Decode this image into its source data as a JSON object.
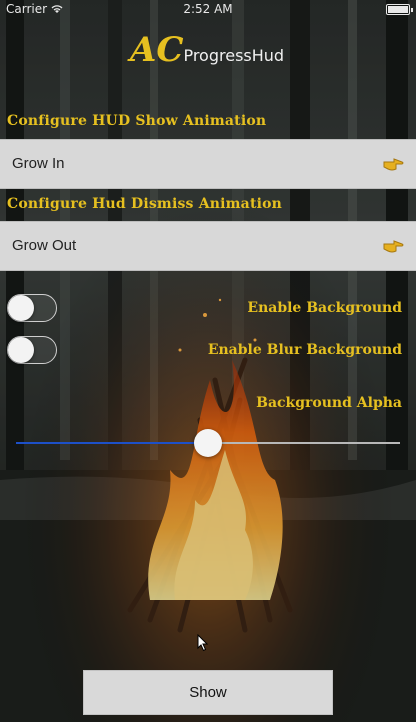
{
  "status_bar": {
    "carrier": "Carrier",
    "time": "2:52 AM"
  },
  "logo": {
    "mark": "AC",
    "name": "ProgressHud"
  },
  "show_animation": {
    "title": "Configure HUD Show Animation",
    "value": "Grow In",
    "icon": "pointing-hand-icon"
  },
  "dismiss_animation": {
    "title": "Configure Hud Dismiss Animation",
    "value": "Grow Out",
    "icon": "pointing-hand-icon"
  },
  "options": {
    "enable_background": {
      "label": "Enable Background",
      "on": false
    },
    "enable_blur": {
      "label": "Enable Blur Background",
      "on": false
    }
  },
  "alpha": {
    "label": "Background Alpha",
    "value": 0.5
  },
  "colors": {
    "accent": "#e6c020",
    "slider_fill": "#1d50c8"
  },
  "show_button": {
    "label": "Show"
  }
}
